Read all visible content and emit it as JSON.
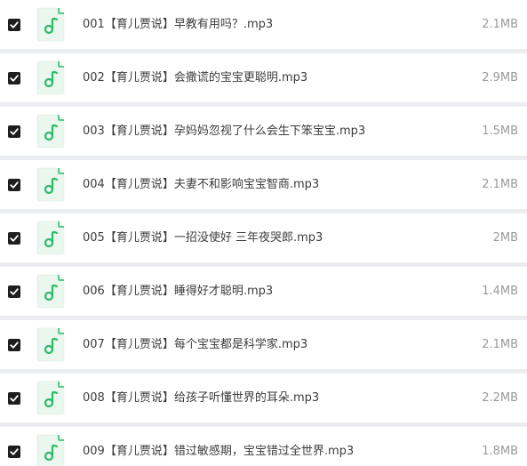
{
  "file_list": {
    "items": [
      {
        "name": "001【育儿贾说】早教有用吗？.mp3",
        "size": "2.1MB",
        "checked": true,
        "icon": "audio-file-icon"
      },
      {
        "name": "002【育儿贾说】会撒谎的宝宝更聪明.mp3",
        "size": "2.9MB",
        "checked": true,
        "icon": "audio-file-icon"
      },
      {
        "name": "003【育儿贾说】孕妈妈忽视了什么会生下笨宝宝.mp3",
        "size": "1.5MB",
        "checked": true,
        "icon": "audio-file-icon"
      },
      {
        "name": "004【育儿贾说】夫妻不和影响宝宝智商.mp3",
        "size": "2.1MB",
        "checked": true,
        "icon": "audio-file-icon"
      },
      {
        "name": "005【育儿贾说】一招没使好 三年夜哭郎.mp3",
        "size": "2MB",
        "checked": true,
        "icon": "audio-file-icon"
      },
      {
        "name": "006【育儿贾说】睡得好才聪明.mp3",
        "size": "1.4MB",
        "checked": true,
        "icon": "audio-file-icon"
      },
      {
        "name": "007【育儿贾说】每个宝宝都是科学家.mp3",
        "size": "2.1MB",
        "checked": true,
        "icon": "audio-file-icon"
      },
      {
        "name": "008【育儿贾说】给孩子听懂世界的耳朵.mp3",
        "size": "2.2MB",
        "checked": true,
        "icon": "audio-file-icon"
      },
      {
        "name": "009【育儿贾说】错过敏感期，宝宝错过全世界.mp3",
        "size": "1.8MB",
        "checked": true,
        "icon": "audio-file-icon"
      }
    ]
  },
  "colors": {
    "icon_green": "#2fb86a",
    "icon_bg": "#e9f7ee",
    "checkbox": "#1e1e1e",
    "text": "#3c3c3c",
    "size_text": "#9a9a9a",
    "background": "#ebedf0"
  }
}
